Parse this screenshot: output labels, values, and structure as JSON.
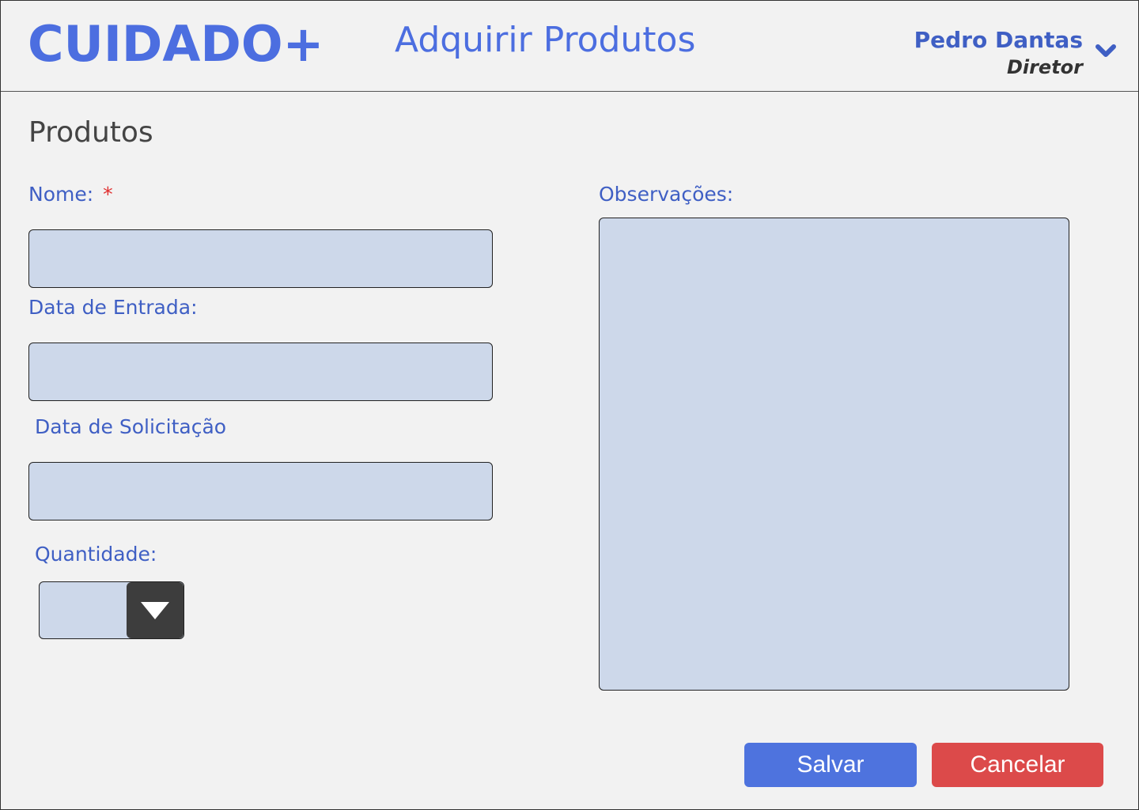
{
  "header": {
    "logo": "CUIDADO+",
    "title": "Adquirir Produtos",
    "user_name": "Pedro Dantas",
    "user_role": "Diretor",
    "menu_icon": "chevron-down-icon"
  },
  "form": {
    "section_title": "Produtos",
    "nome_label": "Nome:",
    "required_mark": "*",
    "nome_value": "",
    "data_entrada_label": "Data de Entrada:",
    "data_entrada_value": "",
    "data_solicitacao_label": "Data de Solicitação",
    "data_solicitacao_value": "",
    "quantidade_label": "Quantidade:",
    "quantidade_value": "",
    "quantidade_icon": "triangle-down-icon",
    "observacoes_label": "Observações:",
    "observacoes_value": ""
  },
  "actions": {
    "save_label": "Salvar",
    "cancel_label": "Cancelar"
  },
  "colors": {
    "brand": "#4c6ee0",
    "label": "#3f5fc4",
    "field_bg": "#cdd8ea",
    "save": "#4e73de",
    "cancel": "#dc4a4a",
    "required": "#e03030"
  }
}
